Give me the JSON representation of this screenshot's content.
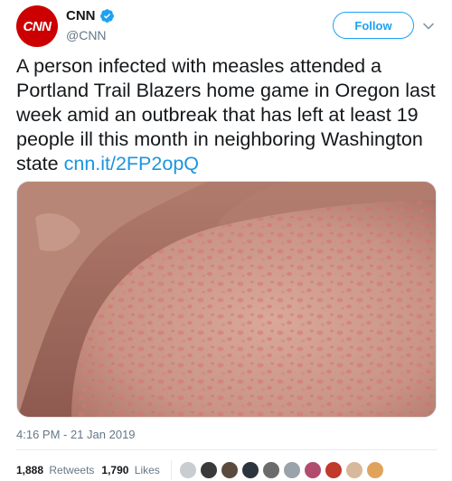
{
  "account": {
    "avatar_text": "CNN",
    "display_name": "CNN",
    "handle": "@CNN",
    "verified": true,
    "brand_color": "#cc0000"
  },
  "actions": {
    "follow_label": "Follow",
    "menu_icon": "chevron-down-icon"
  },
  "tweet": {
    "text": "A person infected with measles attended a Portland Trail Blazers home game in Oregon last week amid an outbreak that has left at least 19 people ill this month in neighboring Washington state",
    "link_text": "cnn.it/2FP2opQ",
    "timestamp": "4:16 PM - 21 Jan 2019"
  },
  "stats": {
    "retweets_count": "1,888",
    "retweets_label": "Retweets",
    "likes_count": "1,790",
    "likes_label": "Likes"
  },
  "colors": {
    "accent": "#1da1f2",
    "link": "#1b95e0",
    "muted": "#657786"
  }
}
